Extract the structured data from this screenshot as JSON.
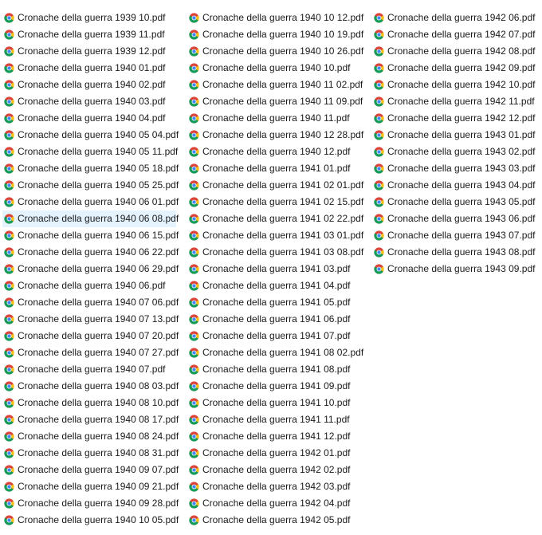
{
  "icon": "chrome-pdf-icon",
  "selected_index": 12,
  "colors": {
    "selection": "#e5f3ff",
    "chrome_red": "#db4437",
    "chrome_yellow": "#f4c20d",
    "chrome_green": "#0f9d58",
    "chrome_blue": "#4285f4"
  },
  "files": [
    "Cronache della guerra 1939 10.pdf",
    "Cronache della guerra 1939 11.pdf",
    "Cronache della guerra 1939 12.pdf",
    "Cronache della guerra 1940 01.pdf",
    "Cronache della guerra 1940 02.pdf",
    "Cronache della guerra 1940 03.pdf",
    "Cronache della guerra 1940 04.pdf",
    "Cronache della guerra 1940 05 04.pdf",
    "Cronache della guerra 1940 05 11.pdf",
    "Cronache della guerra 1940 05 18.pdf",
    "Cronache della guerra 1940 05 25.pdf",
    "Cronache della guerra 1940 06 01.pdf",
    "Cronache della guerra 1940 06 08.pdf",
    "Cronache della guerra 1940 06 15.pdf",
    "Cronache della guerra 1940 06 22.pdf",
    "Cronache della guerra 1940 06 29.pdf",
    "Cronache della guerra 1940 06.pdf",
    "Cronache della guerra 1940 07 06.pdf",
    "Cronache della guerra 1940 07 13.pdf",
    "Cronache della guerra 1940 07 20.pdf",
    "Cronache della guerra 1940 07 27.pdf",
    "Cronache della guerra 1940 07.pdf",
    "Cronache della guerra 1940 08 03.pdf",
    "Cronache della guerra 1940 08 10.pdf",
    "Cronache della guerra 1940 08 17.pdf",
    "Cronache della guerra 1940 08 24.pdf",
    "Cronache della guerra 1940 08 31.pdf",
    "Cronache della guerra 1940 09 07.pdf",
    "Cronache della guerra 1940 09 21.pdf",
    "Cronache della guerra 1940 09 28.pdf",
    "Cronache della guerra 1940 10 05.pdf",
    "Cronache della guerra 1940 10 12.pdf",
    "Cronache della guerra 1940 10 19.pdf",
    "Cronache della guerra 1940 10 26.pdf",
    "Cronache della guerra 1940 10.pdf",
    "Cronache della guerra 1940 11 02.pdf",
    "Cronache della guerra 1940 11 09.pdf",
    "Cronache della guerra 1940 11.pdf",
    "Cronache della guerra 1940 12 28.pdf",
    "Cronache della guerra 1940 12.pdf",
    "Cronache della guerra 1941 01.pdf",
    "Cronache della guerra 1941 02 01.pdf",
    "Cronache della guerra 1941 02 15.pdf",
    "Cronache della guerra 1941 02 22.pdf",
    "Cronache della guerra 1941 03 01.pdf",
    "Cronache della guerra 1941 03 08.pdf",
    "Cronache della guerra 1941 03.pdf",
    "Cronache della guerra 1941 04.pdf",
    "Cronache della guerra 1941 05.pdf",
    "Cronache della guerra 1941 06.pdf",
    "Cronache della guerra 1941 07.pdf",
    "Cronache della guerra 1941 08 02.pdf",
    "Cronache della guerra 1941 08.pdf",
    "Cronache della guerra 1941 09.pdf",
    "Cronache della guerra 1941 10.pdf",
    "Cronache della guerra 1941 11.pdf",
    "Cronache della guerra 1941 12.pdf",
    "Cronache della guerra 1942 01.pdf",
    "Cronache della guerra 1942 02.pdf",
    "Cronache della guerra 1942 03.pdf",
    "Cronache della guerra 1942 04.pdf",
    "Cronache della guerra 1942 05.pdf",
    "Cronache della guerra 1942 06.pdf",
    "Cronache della guerra 1942 07.pdf",
    "Cronache della guerra 1942 08.pdf",
    "Cronache della guerra 1942 09.pdf",
    "Cronache della guerra 1942 10.pdf",
    "Cronache della guerra 1942 11.pdf",
    "Cronache della guerra 1942 12.pdf",
    "Cronache della guerra 1943 01.pdf",
    "Cronache della guerra 1943 02.pdf",
    "Cronache della guerra 1943 03.pdf",
    "Cronache della guerra 1943 04.pdf",
    "Cronache della guerra 1943 05.pdf",
    "Cronache della guerra 1943 06.pdf",
    "Cronache della guerra 1943 07.pdf",
    "Cronache della guerra 1943 08.pdf",
    "Cronache della guerra 1943 09.pdf"
  ]
}
